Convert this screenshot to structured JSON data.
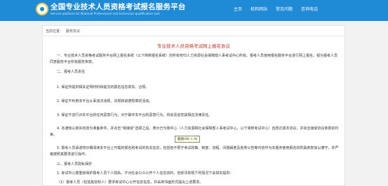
{
  "header": {
    "title": "全国专业技术人员资格考试报名服务平台",
    "subtitle": "Service platform for National Professional and technician qualification test",
    "nav": [
      "主页",
      "机构网站",
      "常见问题",
      "咨询电话"
    ]
  },
  "breadcrumb": {
    "label": "当前位置：",
    "current": "服务协议"
  },
  "doc_title": "专业技术人员资格考试网上报名协议",
  "paragraphs": [
    "一、专业技术人员资格考试服务平台网上报名系统（以下简称报名系统）的所有权归人力资源社会保障部人事考试中心所有。报考人员使用报名服务平台进行网上报名，视为报考人员同意服务平台所有服务条款。",
    "二、报考人员责任",
    "1. 保证所提供相关证明材料和提交的报名信息真实、合规。",
    "2. 保证不利用本平台从事违法违规、法规和道德规章的活动。",
    "3. 保证不进行对本平台的任何恶意行为，对于破坏本平台的恶意行为，将追责追究其相应法律责任。",
    "4. 本通知以真实有效为准备条件，并点击“我接受”选择之后，表示已与我中心（人力资源和社会保障部人事考试中心，以下简称考试中心）自愿达成本协议，并完全接受协议条款的约束。",
    "5. 报考人员承诺将仔细阅读本平台上刊载的报名和考试的有关信息，包括但不限于考试政策、制度、流程、问题解答及各类公告等内容作为本服务使用报名的附属条款加以遵守，并严格按照其要求进行操作。",
    "三、报考人员隐私保护",
    "1. 考试中心尊重和保护报考人员个人隐私，不对社会公众公开个人信息资料，但依法依规下列情况下会如实提供：",
    "（1）报考人员（包括其授权人）要求考试中心公开信息信息，并采用书面形式提出上述要求。"
  ],
  "tooltip": "截图(Alt + A)"
}
